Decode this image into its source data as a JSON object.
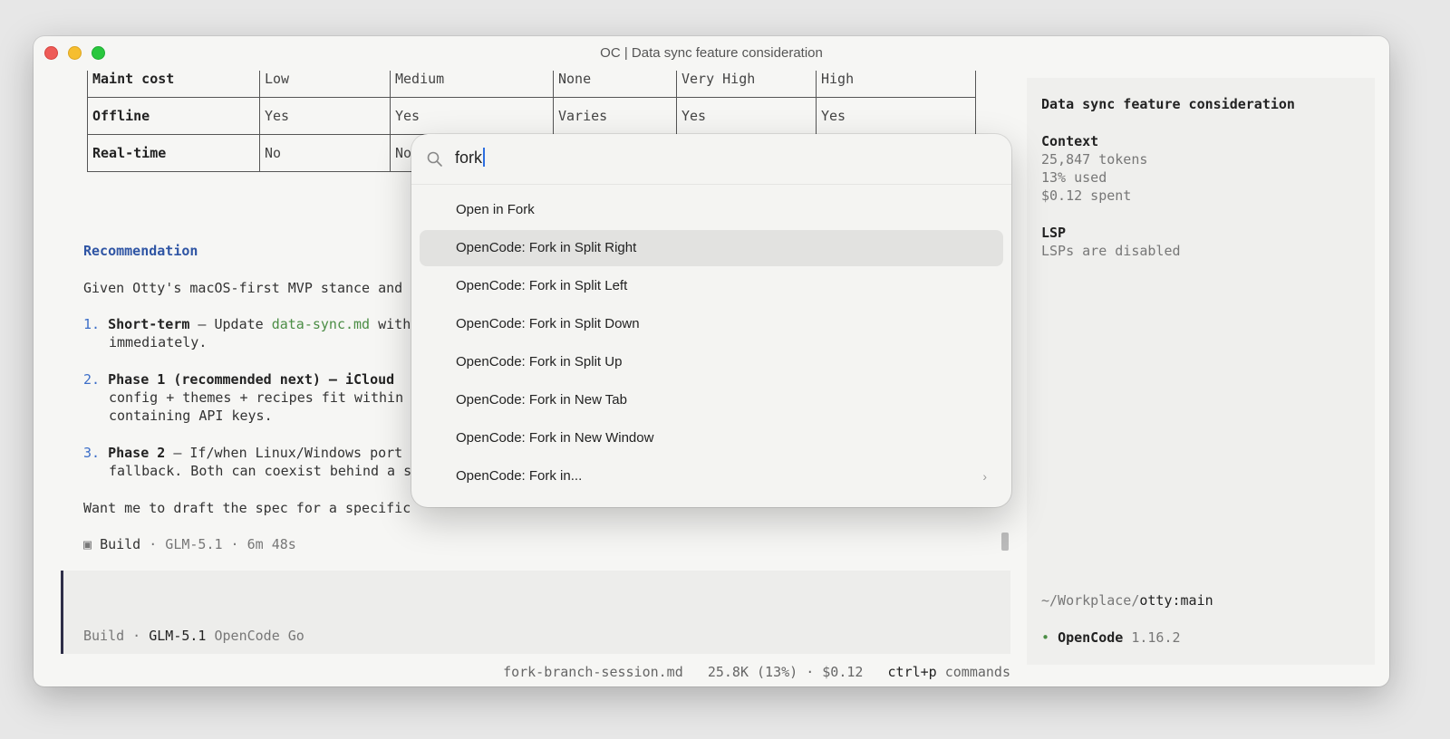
{
  "window": {
    "title": "OC | Data sync feature consideration"
  },
  "comparison_table": {
    "rows": [
      {
        "label": "Maint cost",
        "cells": [
          "Low",
          "Medium",
          "None",
          "Very High",
          "High"
        ]
      },
      {
        "label": "Offline",
        "cells": [
          "Yes",
          "Yes",
          "Varies",
          "Yes",
          "Yes"
        ]
      },
      {
        "label": "Real-time",
        "cells": [
          "No",
          "No",
          "",
          "",
          ""
        ]
      }
    ]
  },
  "transcript": {
    "heading": "Recommendation",
    "intro": "Given Otty's macOS-first MVP stance and",
    "items": [
      {
        "num": "1.",
        "title": "Short-term",
        "dash": " — Update ",
        "path": "data-sync.md",
        "rest": " with",
        "line2": "immediately."
      },
      {
        "num": "2.",
        "title": "Phase 1 (recommended next) — iCloud",
        "line2": "config + themes + recipes fit within",
        "line3": "containing API keys."
      },
      {
        "num": "3.",
        "title": "Phase 2",
        "rest": " — If/when Linux/Windows port",
        "line2": "fallback. Both can coexist behind a s"
      }
    ],
    "question": "Want me to draft the spec for a specific",
    "build_icon": "▣",
    "build_label": "Build",
    "build_meta": " · GLM-5.1 · 6m 48s"
  },
  "prompt": {
    "mode": "Build",
    "sep": " · ",
    "model": "GLM-5.1",
    "provider": " OpenCode Go"
  },
  "status_bar": {
    "file": "fork-branch-session.md",
    "usage": "25.8K (13%) · $0.12",
    "shortcut": "ctrl+p",
    "shortcut_label": " commands"
  },
  "sidebar": {
    "session_title": "Data sync feature consideration",
    "context_heading": "Context",
    "tokens": "25,847 tokens",
    "used": "13% used",
    "spent": "$0.12 spent",
    "lsp_heading": "LSP",
    "lsp_status": "LSPs are disabled",
    "cwd_prefix": "~/Workplace/",
    "cwd_repo": "otty:main",
    "app_bullet": "•",
    "app_name": "OpenCode",
    "app_version": " 1.16.2"
  },
  "palette": {
    "query": "fork",
    "items": [
      {
        "label": "Open in Fork"
      },
      {
        "label": "OpenCode: Fork in Split Right",
        "selected": true
      },
      {
        "label": "OpenCode: Fork in Split Left"
      },
      {
        "label": "OpenCode: Fork in Split Down"
      },
      {
        "label": "OpenCode: Fork in Split Up"
      },
      {
        "label": "OpenCode: Fork in New Tab"
      },
      {
        "label": "OpenCode: Fork in New Window"
      },
      {
        "label": "OpenCode: Fork in...",
        "submenu_icon": "chevron-right-icon"
      }
    ]
  }
}
